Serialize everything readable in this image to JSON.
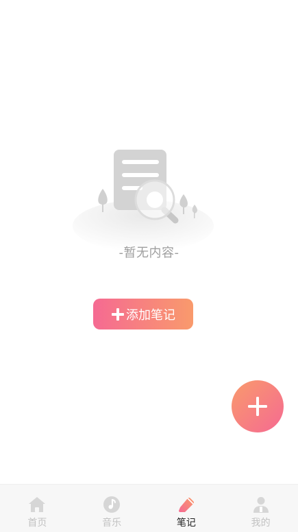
{
  "empty_state": {
    "text": "-暂无内容-",
    "illustration_icon": "empty-document-search-icon"
  },
  "add_note_button": {
    "label": "添加笔记",
    "icon": "plus-icon"
  },
  "fab": {
    "icon": "plus-icon"
  },
  "tabbar": {
    "items": [
      {
        "label": "首页",
        "icon": "home-icon",
        "active": false
      },
      {
        "label": "音乐",
        "icon": "music-note-icon",
        "active": false
      },
      {
        "label": "笔记",
        "icon": "pencil-icon",
        "active": true
      },
      {
        "label": "我的",
        "icon": "user-icon",
        "active": false
      }
    ]
  },
  "colors": {
    "gradient_start": "#f56a92",
    "gradient_end": "#f99a6c",
    "tab_inactive": "#c2c2c2",
    "tab_active": "#222222",
    "empty_text": "#9e9e9e"
  }
}
